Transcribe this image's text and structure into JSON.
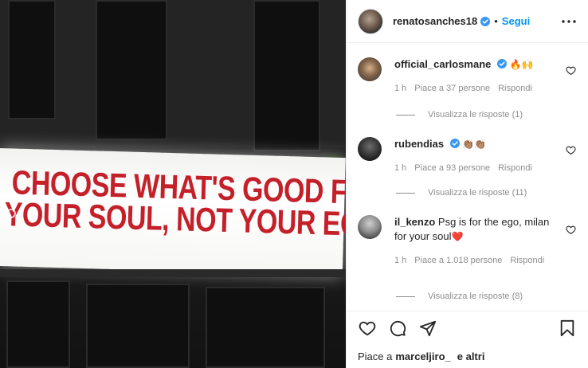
{
  "post": {
    "image_text": {
      "line1": "CHOOSE WHAT'S GOOD FOR",
      "line2": "YOUR SOUL, NOT YOUR EGO"
    }
  },
  "header": {
    "username": "renatosanches18",
    "follow_label": "Segui",
    "verified": true,
    "more_icon": "more-horizontal-icon"
  },
  "comments": [
    {
      "username": "official_carlosmane",
      "verified": true,
      "text": "",
      "emoji": "🔥🙌",
      "time": "1 h",
      "likes": "Piace a 37 persone",
      "reply_label": "Rispondi",
      "view_replies": "Visualizza le risposte (1)"
    },
    {
      "username": "rubendias",
      "verified": true,
      "text": "",
      "emoji": "👏🏽👏🏽",
      "time": "1 h",
      "likes": "Piace a 93 persone",
      "reply_label": "Rispondi",
      "view_replies": "Visualizza le risposte (11)"
    },
    {
      "username": "il_kenzo",
      "verified": false,
      "text": "Psg is for the ego, milan for your soul",
      "emoji": "❤️",
      "time": "1 h",
      "likes": "Piace a 1.018 persone",
      "reply_label": "Rispondi",
      "view_replies": "Visualizza le risposte (8)"
    }
  ],
  "actions": {
    "like_icon": "heart-icon",
    "comment_icon": "comment-icon",
    "share_icon": "share-icon",
    "save_icon": "bookmark-icon"
  },
  "likes_line": {
    "prefix": "Piace a",
    "user": "marceljiro_",
    "suffix": "e altri"
  },
  "colors": {
    "accent_blue": "#0095f6",
    "sign_red": "#c4202a",
    "muted_text": "#8e8e8e"
  }
}
